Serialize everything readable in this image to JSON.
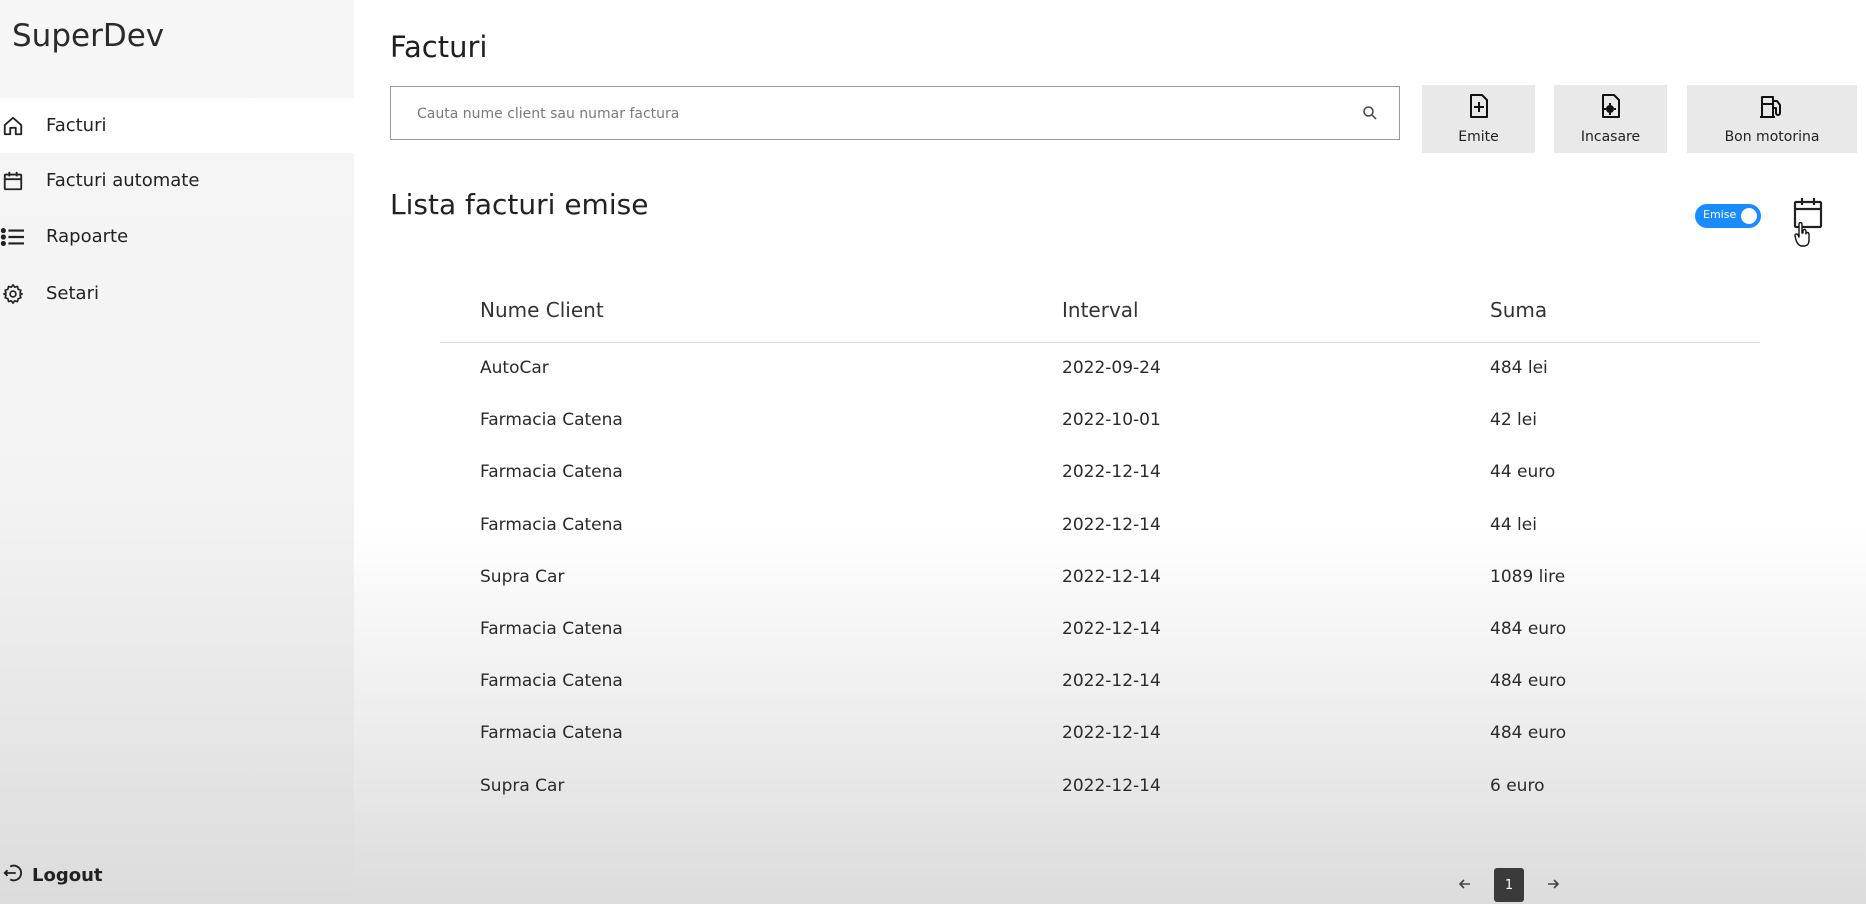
{
  "app": {
    "title": "SuperDev"
  },
  "sidebar": {
    "items": [
      {
        "label": "Facturi",
        "icon": "home-icon",
        "active": true
      },
      {
        "label": "Facturi automate",
        "icon": "calendar-icon"
      },
      {
        "label": "Rapoarte",
        "icon": "list-icon"
      },
      {
        "label": "Setari",
        "icon": "gear-icon"
      }
    ],
    "logout_label": "Logout"
  },
  "header": {
    "title": "Facturi",
    "search_placeholder": "Cauta nume client sau numar factura"
  },
  "actions": [
    {
      "label": "Emite",
      "icon": "file-plus-icon"
    },
    {
      "label": "Incasare",
      "icon": "file-settings-icon"
    },
    {
      "label": "Bon motorina",
      "icon": "fuel-pump-icon"
    }
  ],
  "list": {
    "title": "Lista facturi emise",
    "toggle_label": "Emise",
    "toggle_on": true,
    "accent_color": "#1a8cff",
    "columns": [
      "Nume Client",
      "Interval",
      "Suma"
    ],
    "rows": [
      {
        "client": "AutoCar",
        "interval": "2022-09-24",
        "suma": "484 lei"
      },
      {
        "client": "Farmacia Catena",
        "interval": "2022-10-01",
        "suma": "42 lei"
      },
      {
        "client": "Farmacia Catena",
        "interval": "2022-12-14",
        "suma": "44 euro"
      },
      {
        "client": "Farmacia Catena",
        "interval": "2022-12-14",
        "suma": "44 lei"
      },
      {
        "client": "Supra Car",
        "interval": "2022-12-14",
        "suma": "1089 lire"
      },
      {
        "client": "Farmacia Catena",
        "interval": "2022-12-14",
        "suma": "484 euro"
      },
      {
        "client": "Farmacia Catena",
        "interval": "2022-12-14",
        "suma": "484 euro"
      },
      {
        "client": "Farmacia Catena",
        "interval": "2022-12-14",
        "suma": "484 euro"
      },
      {
        "client": "Supra Car",
        "interval": "2022-12-14",
        "suma": "6 euro"
      }
    ]
  },
  "pagination": {
    "current": "1"
  }
}
